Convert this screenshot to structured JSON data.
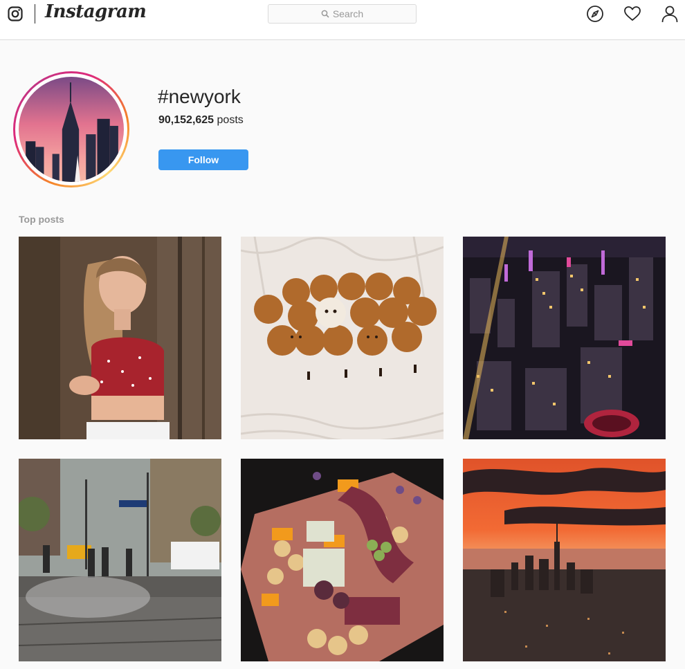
{
  "nav": {
    "wordmark": "Instagram",
    "search_placeholder": "Search",
    "icons": [
      "instagram-glyph-icon",
      "search-icon",
      "compass-icon",
      "heart-icon",
      "profile-icon"
    ]
  },
  "hashtag": {
    "name": "#newyork",
    "post_count": "90,152,625",
    "post_suffix": " posts",
    "follow_label": "Follow"
  },
  "section": {
    "top_posts_label": "Top posts"
  },
  "posts": [
    {
      "subject": "woman-in-red-top"
    },
    {
      "subject": "pomeranian-puppies"
    },
    {
      "subject": "city-at-night-aerial"
    },
    {
      "subject": "rainy-street-corner"
    },
    {
      "subject": "charcuterie-board"
    },
    {
      "subject": "sunset-skyline"
    }
  ],
  "colors": {
    "follow_button": "#3897f0",
    "background": "#fafafa",
    "text": "#262626",
    "muted": "#999999"
  }
}
